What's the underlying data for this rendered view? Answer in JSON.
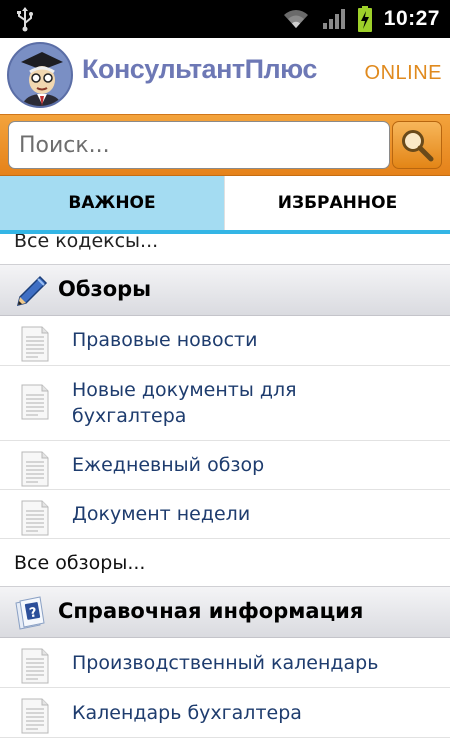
{
  "status_bar": {
    "time": "10:27",
    "icons": [
      "usb-icon",
      "wifi-icon",
      "signal-icon",
      "battery-charging-icon"
    ]
  },
  "header": {
    "brand": "КонсультантПлюс",
    "online": "ONLINE"
  },
  "search": {
    "placeholder": "Поиск...",
    "button_icon": "search-icon"
  },
  "tabs": [
    {
      "label": "ВАЖНОЕ",
      "active": true
    },
    {
      "label": "ИЗБРАННОЕ",
      "active": false
    }
  ],
  "list": {
    "top_cut_link": "Все кодексы...",
    "sections": [
      {
        "title": "Обзоры",
        "icon": "pencil-icon",
        "items": [
          {
            "lines": [
              "Правовые новости"
            ]
          },
          {
            "lines": [
              "Новые документы для",
              "бухгалтера"
            ]
          },
          {
            "lines": [
              "Ежедневный обзор"
            ]
          },
          {
            "lines": [
              "Документ недели"
            ]
          }
        ],
        "more": "Все обзоры..."
      },
      {
        "title": "Справочная информация",
        "icon": "help-book-icon",
        "items": [
          {
            "lines": [
              "Производственный календарь"
            ]
          },
          {
            "lines": [
              "Календарь бухгалтера"
            ]
          }
        ]
      }
    ]
  },
  "colors": {
    "accent_orange": "#e5821a",
    "brand_blue": "#6d78b5",
    "tab_active_bg": "#a4dcf2",
    "tab_indicator": "#33b5e5",
    "link_text": "#1e3c6e"
  }
}
